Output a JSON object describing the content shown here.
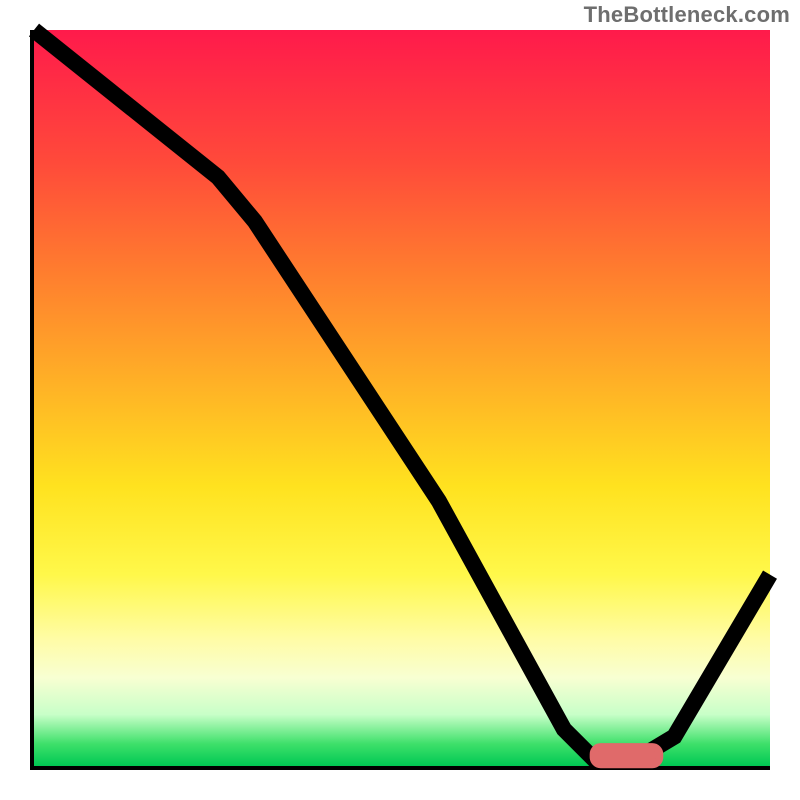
{
  "watermark": "TheBottleneck.com",
  "chart_data": {
    "type": "line",
    "title": "",
    "xlabel": "",
    "ylabel": "",
    "xlim": [
      0,
      100
    ],
    "ylim": [
      0,
      100
    ],
    "grid": false,
    "background": "heatmap-gradient-vertical",
    "gradient_stops": [
      {
        "pos": 0.0,
        "color": "#ff1a4b"
      },
      {
        "pos": 0.18,
        "color": "#ff4a3a"
      },
      {
        "pos": 0.32,
        "color": "#ff7a2f"
      },
      {
        "pos": 0.48,
        "color": "#ffb126"
      },
      {
        "pos": 0.62,
        "color": "#ffe21f"
      },
      {
        "pos": 0.74,
        "color": "#fff84a"
      },
      {
        "pos": 0.83,
        "color": "#fffca8"
      },
      {
        "pos": 0.88,
        "color": "#f8ffd2"
      },
      {
        "pos": 0.93,
        "color": "#c8ffc8"
      },
      {
        "pos": 0.97,
        "color": "#3ee06a"
      },
      {
        "pos": 1.0,
        "color": "#00c853"
      }
    ],
    "series": [
      {
        "name": "bottleneck-curve",
        "x": [
          0,
          10,
          25,
          30,
          55,
          72,
          76,
          82,
          87,
          100
        ],
        "y": [
          100,
          92,
          80,
          74,
          36,
          5,
          1,
          1,
          4,
          26
        ]
      }
    ],
    "marker": {
      "name": "optimal-range",
      "shape": "rounded-bar",
      "x_range": [
        76,
        85
      ],
      "y": 1.2,
      "color": "#e06a6a"
    }
  }
}
